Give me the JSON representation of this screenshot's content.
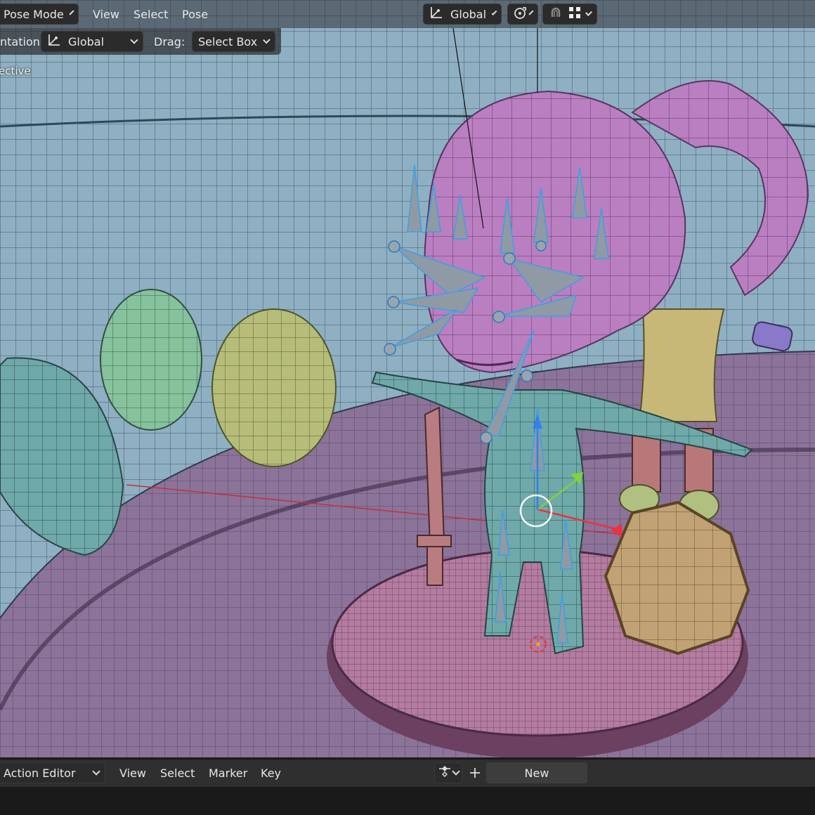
{
  "header": {
    "mode_label": "Pose Mode",
    "menus": [
      "View",
      "Select",
      "Pose"
    ],
    "transform_orientation": "Global",
    "icons": [
      "orientation-axes-icon",
      "pivot-icon",
      "snap-icon",
      "snap-increment-icon"
    ]
  },
  "tool_settings": {
    "orientation_label": "ntation:",
    "orientation_value": "Global",
    "drag_label": "Drag:",
    "drag_value": "Select Box"
  },
  "viewport": {
    "view_name": "ective",
    "colors": {
      "background": "#8fb3c4",
      "floor": "#8a6f9a",
      "platform": "#b47aa0",
      "head": "#b87cc0",
      "body_teal": "#6aa8a8",
      "sphere_green": "#8cc4a0",
      "sphere_yellow": "#b8c07a",
      "shield": "#c2a476",
      "sword": "#b87c80",
      "bones": "#4aa8e8"
    }
  },
  "bottom_editor": {
    "editor_mode": "Action Editor",
    "menus": [
      "View",
      "Select",
      "Marker",
      "Key"
    ],
    "new_label": "New",
    "icons": [
      "keyframe-interpolation-icon",
      "plus-icon"
    ]
  }
}
